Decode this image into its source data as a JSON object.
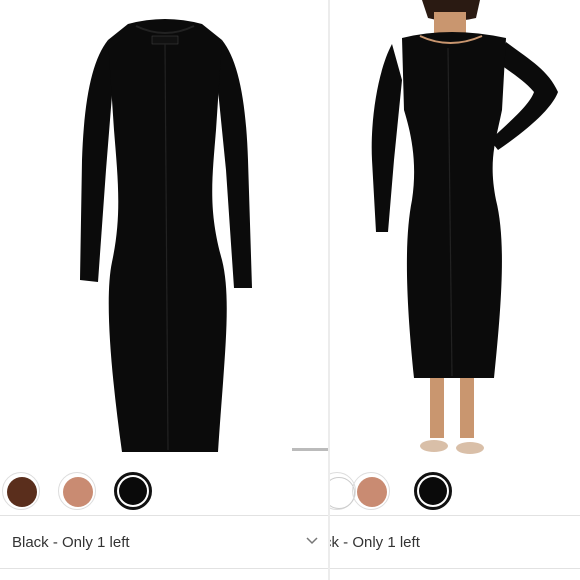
{
  "left_panel": {
    "image_alt": "Black long-sleeve ribbed midi dress, product shot",
    "swatches": [
      {
        "name": "brown",
        "color": "#5a2e1c",
        "selected": false
      },
      {
        "name": "tan",
        "color": "#c98b72",
        "selected": false
      },
      {
        "name": "black",
        "color": "#0a0a0a",
        "selected": true
      }
    ],
    "select_label": "Black - Only 1 left"
  },
  "right_panel": {
    "image_alt": "Model wearing black long-sleeve ribbed midi dress",
    "swatches": [
      {
        "name": "tan",
        "color": "#c98b72",
        "selected": false
      },
      {
        "name": "black",
        "color": "#0a0a0a",
        "selected": true
      }
    ],
    "select_label": "ck - Only 1 left"
  },
  "colors": {
    "dress": "#0b0b0b",
    "skin": "#c9966f",
    "border": "#e2e2e2"
  }
}
